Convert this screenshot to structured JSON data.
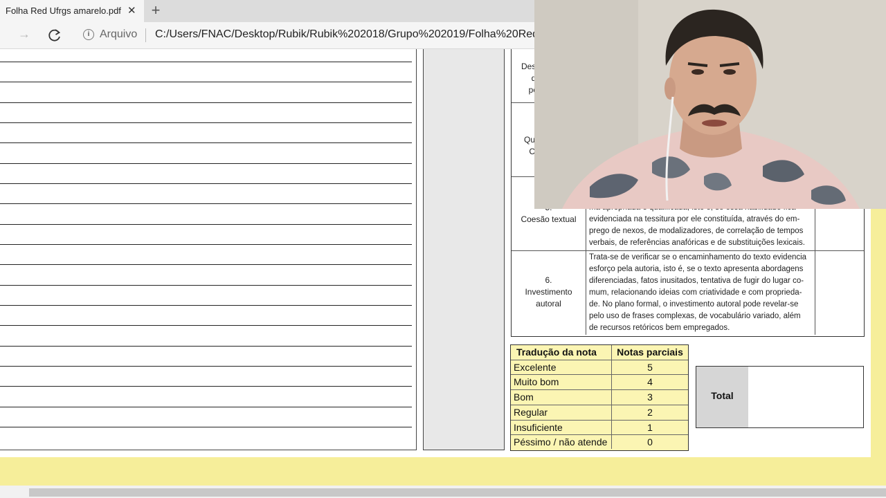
{
  "browser": {
    "tab_title": "Folha Red Ufrgs amarelo.pdf",
    "tab_close": "✕",
    "new_tab": "+",
    "forward": "→",
    "info": "i",
    "site_label": "Arquivo",
    "url": "C:/Users/FNAC/Desktop/Rubik/Rubik%202018/Grupo%202019/Folha%20Red%"
  },
  "criteria_partial": [
    {
      "label_lines": [
        "Dese",
        "do",
        "por"
      ]
    },
    {
      "label_lines": [
        "Qu",
        "C"
      ]
    }
  ],
  "criteria": [
    {
      "label_lines": [
        "5.",
        "Coesão textual"
      ],
      "desc_lines": [
        "ma apropriada e qualificada, isto é, se essa habilidade fica",
        "evidenciada na tessitura por ele constituída, através do em-",
        "prego de nexos, de modalizadores, de correlação de tempos",
        "verbais, de referências anafóricas e de substituições lexicais."
      ]
    },
    {
      "label_lines": [
        "6.",
        "Investimento",
        "autoral"
      ],
      "desc_lines": [
        "Trata-se de verificar se o encaminhamento do texto evidencia",
        "esforço pela autoria, isto é, se o texto apresenta abordagens",
        "diferenciadas, fatos inusitados, tentativa de fugir do lugar co-",
        "mum, relacionando ideias com criatividade e com proprieda-",
        "de. No plano formal, o investimento autoral pode revelar-se",
        "pelo uso de frases complexas, de vocabulário variado, além",
        "de recursos retóricos bem empregados."
      ]
    }
  ],
  "grade_table": {
    "header_label": "Tradução da nota",
    "header_value": "Notas parciais",
    "rows": [
      {
        "label": "Excelente",
        "value": "5"
      },
      {
        "label": "Muito bom",
        "value": "4"
      },
      {
        "label": "Bom",
        "value": "3"
      },
      {
        "label": "Regular",
        "value": "2"
      },
      {
        "label": "Insuficiente",
        "value": "1"
      },
      {
        "label": "Péssimo / não atende",
        "value": "0"
      }
    ]
  },
  "total": {
    "label": "Total",
    "value": ""
  },
  "colors": {
    "viewer_background": "#f6ee9a",
    "grade_table_fill": "#fbf5b3",
    "total_label_fill": "#d6d6d6"
  },
  "webcam": {
    "icon": "webcam-overlay"
  }
}
